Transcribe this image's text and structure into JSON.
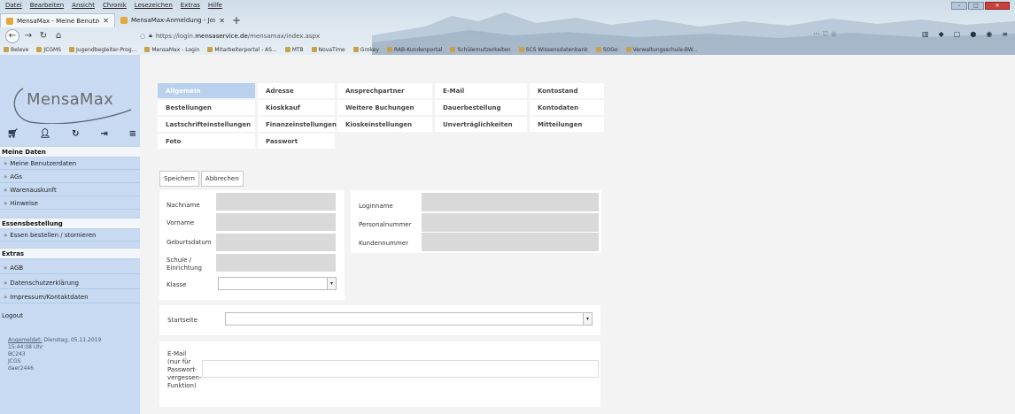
{
  "browser": {
    "menu": [
      "Datei",
      "Bearbeiten",
      "Ansicht",
      "Chronik",
      "Lesezeichen",
      "Extras",
      "Hilfe"
    ],
    "tabs": [
      {
        "title": "MensaMax - Meine Benutzerd:"
      },
      {
        "title": "MensaMax-Anmeldung - Jose..."
      }
    ],
    "new_tab": "+",
    "url_prefix": "https://login.",
    "url_domain": "mensaservice.de",
    "url_path": "/mensamax/index.aspx",
    "url_actions": "··· ♡ ☆",
    "bookmarks": [
      "Beleve",
      "JCGMS",
      "Jugendbegleiter-Prog...",
      "MensaMax - Login",
      "Mitarbeiterportal - AS...",
      "MTB",
      "NovaTime",
      "Grokey",
      "RAB-Kundenportal",
      "Schülernutzerkeiten",
      "SCS Wissensdatenbank",
      "SOGo",
      "Verwaltungsschule-BW..."
    ]
  },
  "sidebar": {
    "logo_text": "MensaMax",
    "icons": [
      "cart-icon",
      "user-icon",
      "refresh-icon",
      "logout-icon",
      "menu-icon"
    ],
    "sections": [
      {
        "title": "Meine Daten",
        "items": [
          "Meine Benutzerdaten",
          "AGs",
          "Warenauskunft",
          "Hinweise"
        ]
      },
      {
        "title": "Essensbestellung",
        "items": [
          "Essen bestellen / stornieren"
        ]
      },
      {
        "title": "Extras",
        "items": [
          "AGB",
          "Datenschutzerklärung",
          "Impressum/Kontaktdaten"
        ]
      }
    ],
    "logout": "Logout",
    "meta": {
      "logged_in_label": "Angemeldet:",
      "logged_in_date": " Dienstag, 05.11.2019",
      "time": "15:44:08 Uhr",
      "line3": "BC243",
      "line4": "JCGS",
      "line5": "daer2446"
    }
  },
  "tabs_grid": [
    {
      "label": "Allgemein",
      "active": true
    },
    {
      "label": "Adresse"
    },
    {
      "label": "Ansprechpartner"
    },
    {
      "label": "E-Mail"
    },
    {
      "label": "Kontostand"
    },
    {
      "label": "Bestellungen"
    },
    {
      "label": "Kioskkauf"
    },
    {
      "label": "Weitere Buchungen"
    },
    {
      "label": "Dauerbestellung"
    },
    {
      "label": "Kontodaten"
    },
    {
      "label": "Lastschrifteinstellungen"
    },
    {
      "label": "Finanzeinstellungen"
    },
    {
      "label": "Kioskeinstellungen"
    },
    {
      "label": "Unverträglichkeiten"
    },
    {
      "label": "Mitteilungen"
    },
    {
      "label": "Foto"
    },
    {
      "label": "Passwort"
    }
  ],
  "actions": {
    "save": "Speichern",
    "cancel": "Abbrechen"
  },
  "personal": {
    "nachname": "Nachname",
    "vorname": "Vorname",
    "geburtsdatum": "Geburtsdatum",
    "schule_l1": "Schule /",
    "schule_l2": "Einrichtung",
    "klasse": "Klasse"
  },
  "login": {
    "loginname": "Loginname",
    "personalnummer": "Personalnummer",
    "kundennummer": "Kundennummer"
  },
  "startseite": {
    "label": "Startseite"
  },
  "email": {
    "l1": "E-Mail",
    "l2": "(nur für",
    "l3": "Passwort-",
    "l4": "vergessen-",
    "l5": "Funktion)"
  },
  "colors": {
    "sidebar": "#c7daf2",
    "active_tab": "#b9d0ee",
    "field": "#d9d9d9"
  }
}
